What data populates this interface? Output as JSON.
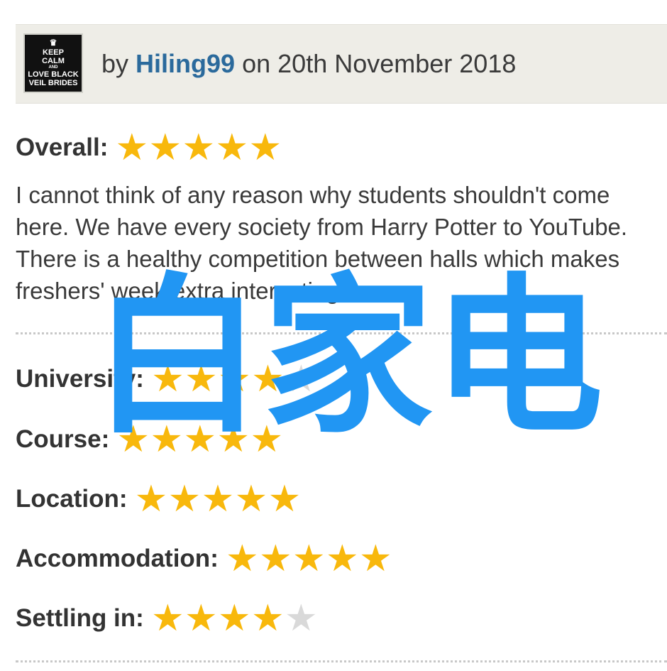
{
  "header": {
    "avatar_lines": [
      "KEEP",
      "CALM",
      "AND",
      "LOVE BLACK",
      "VEIL BRIDES"
    ],
    "by_label": "by",
    "username": "Hiling99",
    "on_label": "on",
    "date": "20th November 2018"
  },
  "overall": {
    "label": "Overall:",
    "rating": 5,
    "max": 5
  },
  "review_text": "I cannot think of any reason why students shouldn't come here. We have every society from Harry Potter to YouTube. There is a healthy competition between halls which makes freshers' week extra interesting.",
  "ratings": [
    {
      "label": "University:",
      "rating": 4,
      "max": 5
    },
    {
      "label": "Course:",
      "rating": 5,
      "max": 5
    },
    {
      "label": "Location:",
      "rating": 5,
      "max": 5
    },
    {
      "label": "Accommodation:",
      "rating": 5,
      "max": 5
    },
    {
      "label": "Settling in:",
      "rating": 4,
      "max": 5
    }
  ],
  "watermark": "白家电",
  "colors": {
    "star_on": "#f8b80c",
    "star_off": "#d9d9d9",
    "username": "#2b6a9c",
    "watermark": "#2196f3",
    "header_bg": "#eeede7"
  }
}
